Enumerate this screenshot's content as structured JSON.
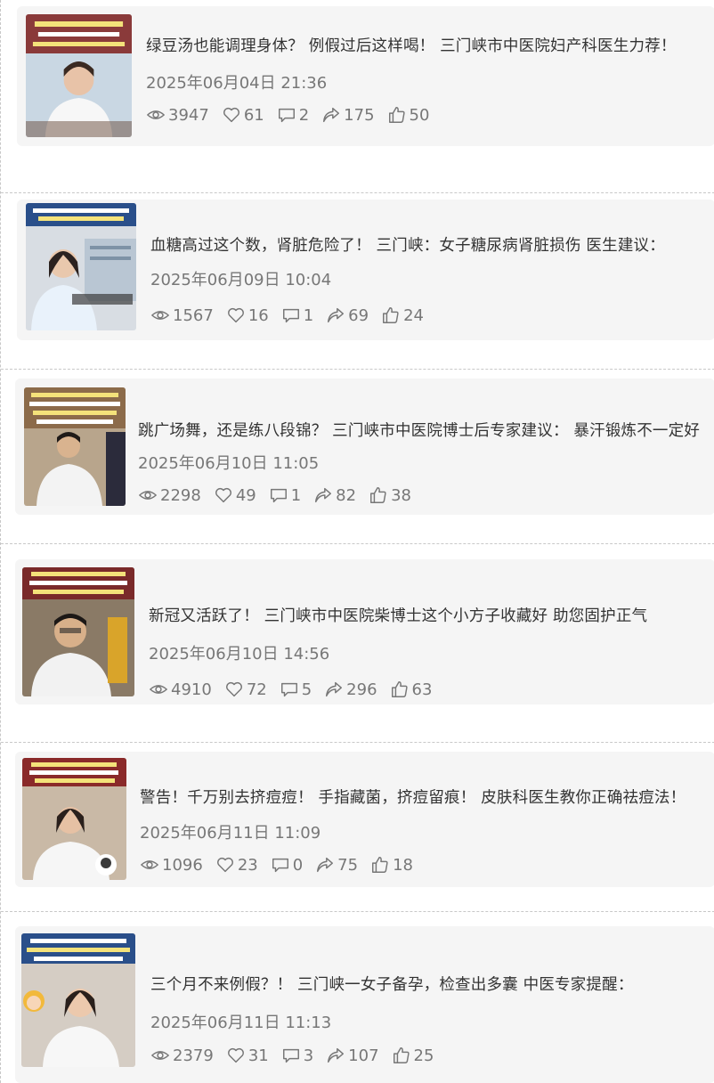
{
  "colors": {
    "card_bg": "#f5f5f5",
    "text": "#333333",
    "meta": "#777777",
    "divider": "#c8c8c8"
  },
  "icons": {
    "views": "eye-icon",
    "likes": "heart-icon",
    "comments": "comment-icon",
    "shares": "share-icon",
    "thumbs": "thumbs-up-icon"
  },
  "posts": [
    {
      "title": "绿豆汤也能调理身体？ 例假过后这样喝！ 三门峡市中医院妇产科医生力荐！",
      "date": "2025年06月04日 21:36",
      "views": "3947",
      "likes": "61",
      "comments": "2",
      "shares": "175",
      "thumbs": "50"
    },
    {
      "title": "血糖高过这个数，肾脏危险了！ 三门峡：女子糖尿病肾脏损伤 医生建议：",
      "date": "2025年06月09日 10:04",
      "views": "1567",
      "likes": "16",
      "comments": "1",
      "shares": "69",
      "thumbs": "24"
    },
    {
      "title": "跳广场舞，还是练八段锦？ 三门峡市中医院博士后专家建议： 暴汗锻炼不一定好",
      "date": "2025年06月10日 11:05",
      "views": "2298",
      "likes": "49",
      "comments": "1",
      "shares": "82",
      "thumbs": "38"
    },
    {
      "title": "新冠又活跃了！ 三门峡市中医院柴博士这个小方子收藏好 助您固护正气",
      "date": "2025年06月10日 14:56",
      "views": "4910",
      "likes": "72",
      "comments": "5",
      "shares": "296",
      "thumbs": "63"
    },
    {
      "title": "警告！千万别去挤痘痘！ 手指藏菌，挤痘留痕！ 皮肤科医生教你正确祛痘法！",
      "date": "2025年06月11日 11:09",
      "views": "1096",
      "likes": "23",
      "comments": "0",
      "shares": "75",
      "thumbs": "18"
    },
    {
      "title": "三个月不来例假？！ 三门峡一女子备孕，检查出多囊 中医专家提醒：",
      "date": "2025年06月11日 11:13",
      "views": "2379",
      "likes": "31",
      "comments": "3",
      "shares": "107",
      "thumbs": "25"
    }
  ]
}
